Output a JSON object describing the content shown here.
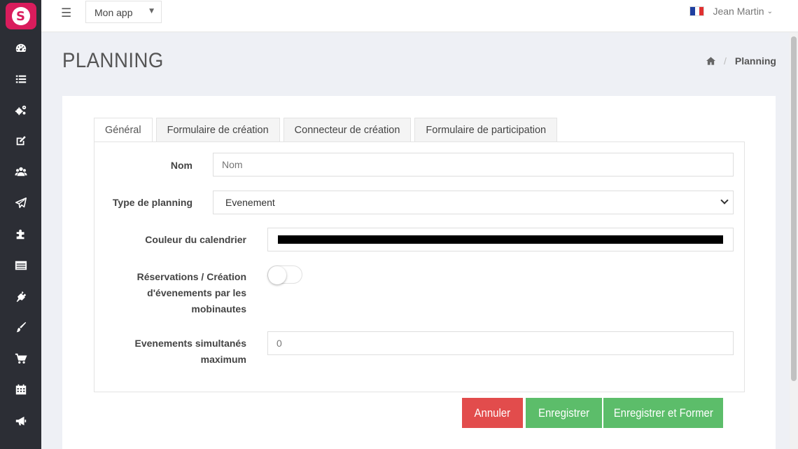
{
  "app": {
    "logo_letter": "S",
    "selected_app": "Mon app"
  },
  "sidebar": {
    "items": [
      {
        "icon": "dashboard-icon"
      },
      {
        "icon": "list-icon"
      },
      {
        "icon": "cogs-icon"
      },
      {
        "icon": "edit-icon"
      },
      {
        "icon": "users-icon"
      },
      {
        "icon": "send-icon"
      },
      {
        "icon": "puzzle-icon"
      },
      {
        "icon": "table-icon"
      },
      {
        "icon": "plug-icon"
      },
      {
        "icon": "brush-icon"
      },
      {
        "icon": "cart-icon"
      },
      {
        "icon": "calendar-icon"
      },
      {
        "icon": "bullhorn-icon"
      }
    ]
  },
  "user": {
    "name": "Jean Martin"
  },
  "header": {
    "title": "PLANNING",
    "breadcrumb_current": "Planning"
  },
  "tabs": [
    {
      "label": "Général",
      "active": true
    },
    {
      "label": "Formulaire de création",
      "active": false
    },
    {
      "label": "Connecteur de création",
      "active": false
    },
    {
      "label": "Formulaire de participation",
      "active": false
    }
  ],
  "form": {
    "nom": {
      "label": "Nom",
      "placeholder": "Nom"
    },
    "type": {
      "label": "Type de planning",
      "value": "Evenement"
    },
    "couleur": {
      "label": "Couleur du calendrier",
      "value": "#000000"
    },
    "reservations": {
      "label_line1": "Réservations / Création",
      "label_line2": "d'évenements par les",
      "label_line3": "mobinautes",
      "enabled": false
    },
    "simultanes": {
      "label_line1": "Evenements simultanés",
      "label_line2": "maximum",
      "value": "0"
    }
  },
  "buttons": {
    "cancel": "Annuler",
    "save": "Enregistrer",
    "save_and_form": "Enregistrer et Former"
  },
  "colors": {
    "sidebar": "#2c2e35",
    "brand": "#d91c5c",
    "danger": "#e24c4c",
    "success": "#5cbd6a"
  }
}
